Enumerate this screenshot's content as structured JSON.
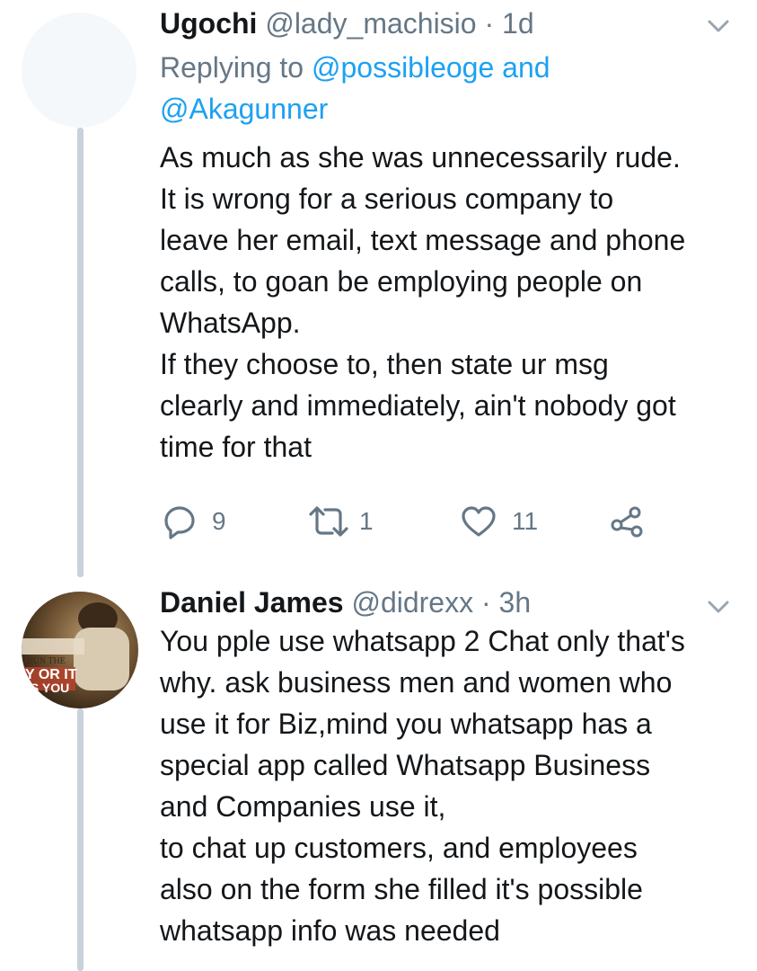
{
  "tweets": [
    {
      "display_name": "Ugochi",
      "handle": "@lady_machisio",
      "separator": "·",
      "time": "1d",
      "reply_prefix": "Replying to",
      "reply_mention_1": "@possibleoge",
      "reply_and": "and",
      "reply_mention_2": "@Akagunner",
      "lines": [
        "As much as she was unnecessarily rude.",
        "It is wrong for a serious company to",
        "leave her email, text message and phone",
        "calls, to goan be employing people on",
        "WhatsApp.",
        "If they choose to, then state ur msg",
        "clearly and immediately, ain't nobody got",
        "time for that"
      ],
      "actions": {
        "reply_count": "9",
        "retweet_count": "1",
        "like_count": "11"
      }
    },
    {
      "display_name": "Daniel James",
      "handle": "@didrexx",
      "separator": "·",
      "time": "3h",
      "avatar_text_1": "BUN THE",
      "avatar_text_2": "Y OR IT",
      "avatar_text_3": "IS YOU",
      "lines": [
        "You pple use whatsapp 2 Chat only that's",
        "why. ask business men and women who",
        "use it for Biz,mind you whatsapp has a",
        "special app called Whatsapp Business",
        "and Companies use it,",
        "to chat up customers, and employees",
        "also on the form she filled it's possible",
        "whatsapp info was needed"
      ]
    }
  ],
  "colors": {
    "link": "#1da1f2",
    "secondary_text": "#657786",
    "thread_line": "#c8d2da"
  },
  "icons": [
    "reply-icon",
    "retweet-icon",
    "like-icon",
    "share-icon",
    "chevron-down-icon"
  ]
}
